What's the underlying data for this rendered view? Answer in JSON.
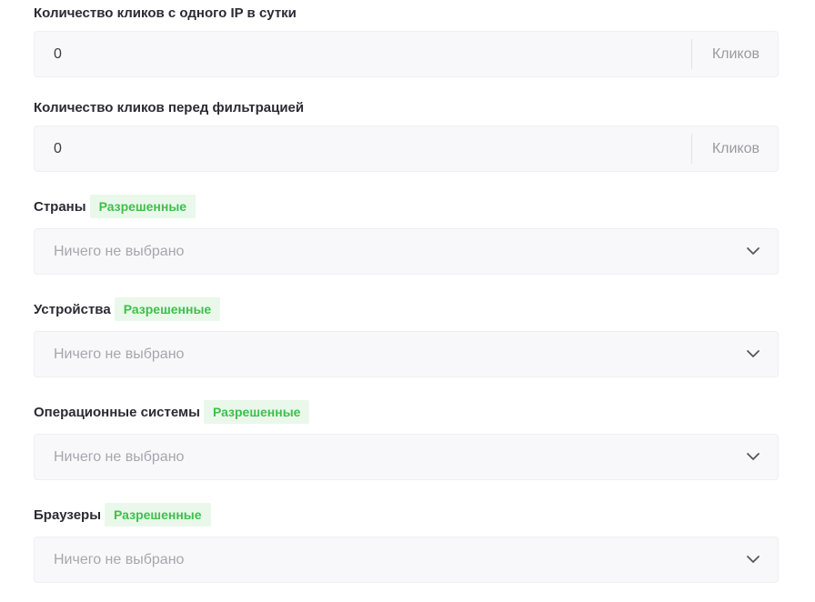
{
  "fields": {
    "clicks_per_ip": {
      "label": "Количество кликов с одного IP в сутки",
      "value": "0",
      "suffix": "Кликов"
    },
    "clicks_before_filter": {
      "label": "Количество кликов перед фильтрацией",
      "value": "0",
      "suffix": "Кликов"
    }
  },
  "selects": {
    "countries": {
      "label": "Страны",
      "badge": "Разрешенные",
      "placeholder": "Ничего не выбрано"
    },
    "devices": {
      "label": "Устройства",
      "badge": "Разрешенные",
      "placeholder": "Ничего не выбрано"
    },
    "os": {
      "label": "Операционные системы",
      "badge": "Разрешенные",
      "placeholder": "Ничего не выбрано"
    },
    "browsers": {
      "label": "Браузеры",
      "badge": "Разрешенные",
      "placeholder": "Ничего не выбрано"
    }
  },
  "icons": {
    "chevron": "chevron-down-icon"
  },
  "colors": {
    "badge_bg": "#e9f8ea",
    "badge_text": "#3fbf4c",
    "field_bg": "#f8f8fa"
  }
}
